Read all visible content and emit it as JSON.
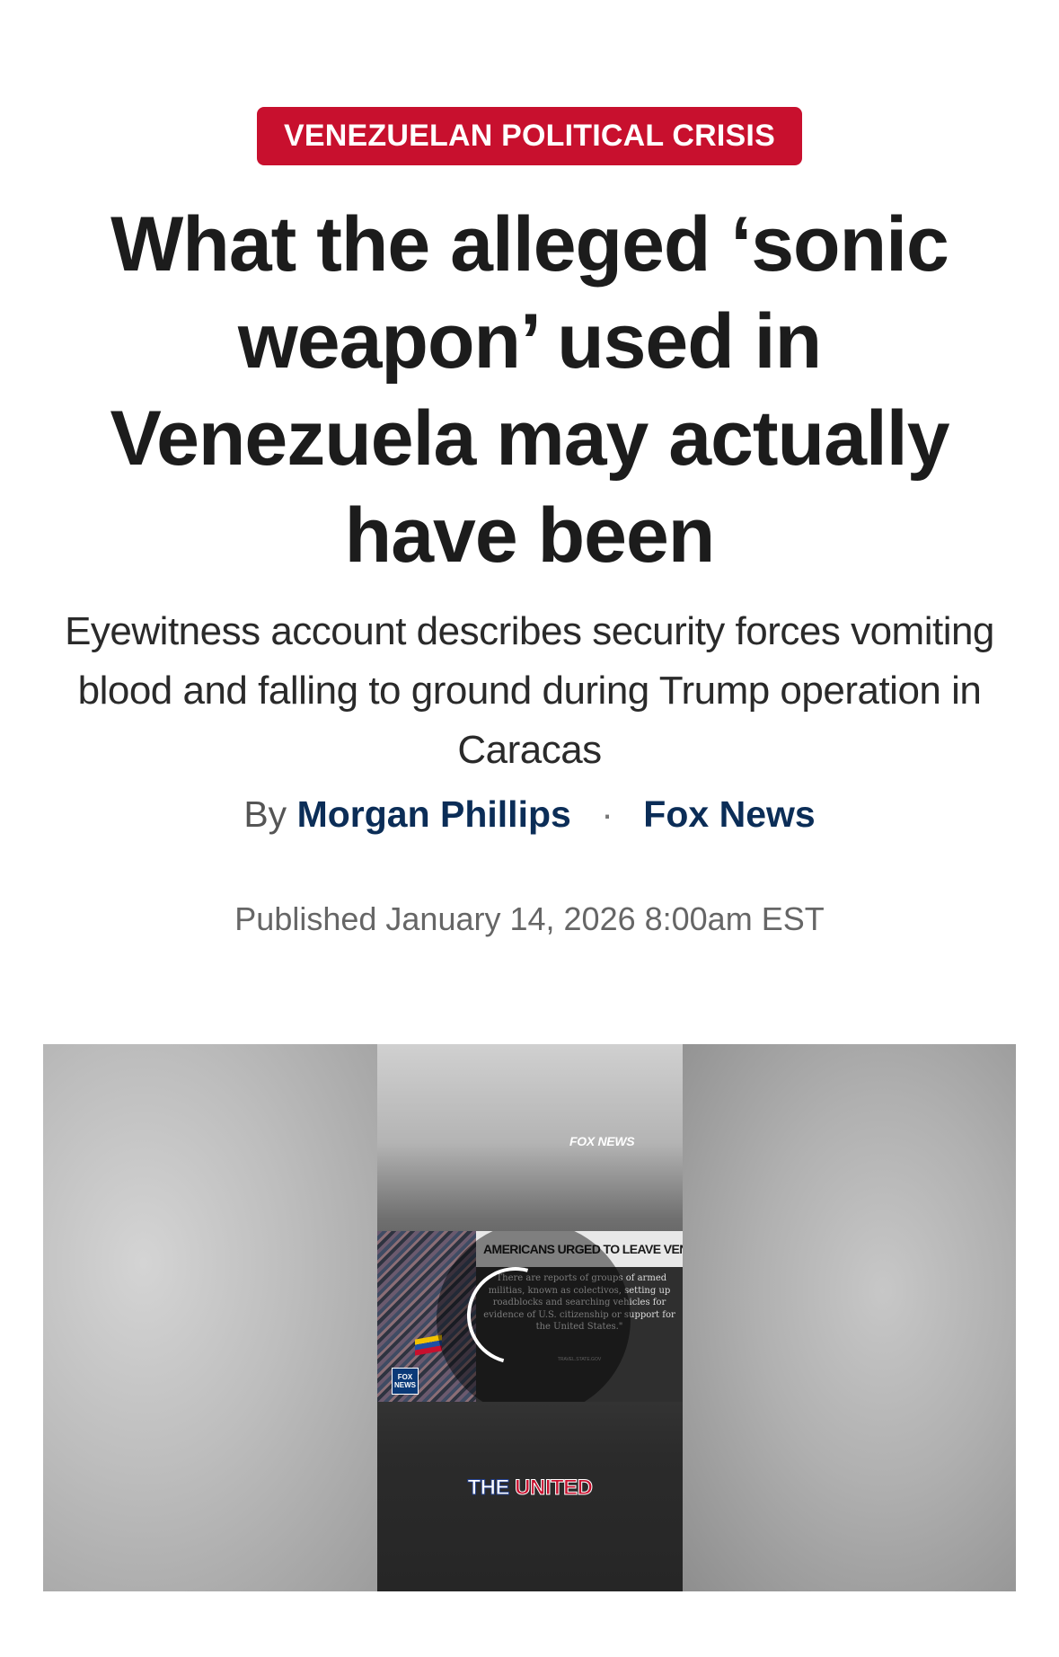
{
  "article": {
    "category": "VENEZUELAN POLITICAL CRISIS",
    "headline": "What the alleged ‘sonic weapon’ used in Venezuela may actually have been",
    "subheadline": "Eyewitness account describes security forces vomiting blood and falling to ground during Trump operation in Caracas",
    "byline": {
      "prefix": "By",
      "author": "Morgan Phillips",
      "separator": "·",
      "outlet": "Fox News"
    },
    "published": "Published January 14, 2026 8:00am EST"
  },
  "video": {
    "watermark": "FOX NEWS",
    "lower_third_title": "AMERICANS URGED TO LEAVE VENEZUELA",
    "quote": "\"There are reports of groups of armed militias, known as colectivos, setting up roadblocks and searching vehicles for evidence of U.S. citizenship or support for the United States.\"",
    "quote_credit": "TRAVEL.STATE.GOV",
    "channel_logo": "FOX NEWS",
    "caption_word_1": "THE",
    "caption_word_2": "UNITED"
  },
  "colors": {
    "accent_red": "#c8102e",
    "byline_navy": "#0b2d57"
  },
  "icons": [
    "loading-spinner-icon",
    "fox-news-logo-icon"
  ]
}
